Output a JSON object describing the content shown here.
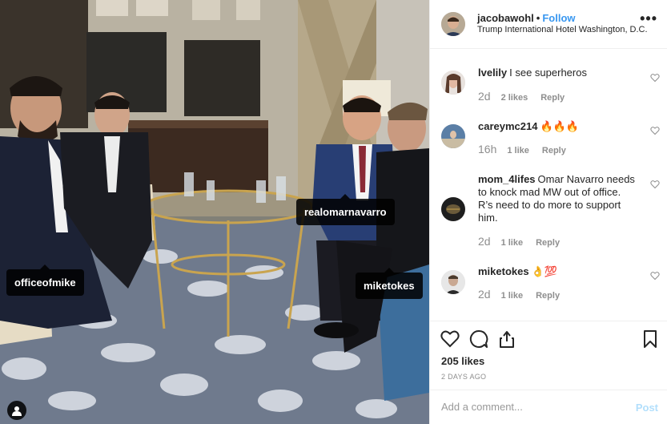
{
  "post": {
    "username": "jacobawohl",
    "separator": "•",
    "follow_label": "Follow",
    "location": "Trump International Hotel Washington, D.C.",
    "more_label": "•••"
  },
  "photo_tags": {
    "officeofmike": "officeofmike",
    "realomarnavarro": "realomarnavarro",
    "miketokes": "miketokes"
  },
  "comments": [
    {
      "user": "lvelily",
      "text": "I see superheros",
      "time": "2d",
      "likes": "2 likes",
      "reply": "Reply"
    },
    {
      "user": "careymc214",
      "text": "🔥🔥🔥",
      "time": "16h",
      "likes": "1 like",
      "reply": "Reply"
    },
    {
      "user": "mom_4lifes",
      "text": "Omar Navarro needs to knock mad MW out of office. R’s need to do more to support him.",
      "time": "2d",
      "likes": "1 like",
      "reply": "Reply"
    },
    {
      "user": "miketokes",
      "text": "👌💯",
      "time": "2d",
      "likes": "1 like",
      "reply": "Reply"
    }
  ],
  "engagement": {
    "likes": "205 likes",
    "date": "2 DAYS AGO"
  },
  "add_comment": {
    "placeholder": "Add a comment...",
    "post_label": "Post"
  },
  "colors": {
    "accent": "#3897f0",
    "post_disabled": "#b2dffc",
    "muted": "#8e8e8e",
    "text": "#262626",
    "border": "#efefef"
  },
  "icons": [
    "heart-icon",
    "comment-icon",
    "share-icon",
    "bookmark-icon",
    "user-tag-icon",
    "more-icon"
  ]
}
